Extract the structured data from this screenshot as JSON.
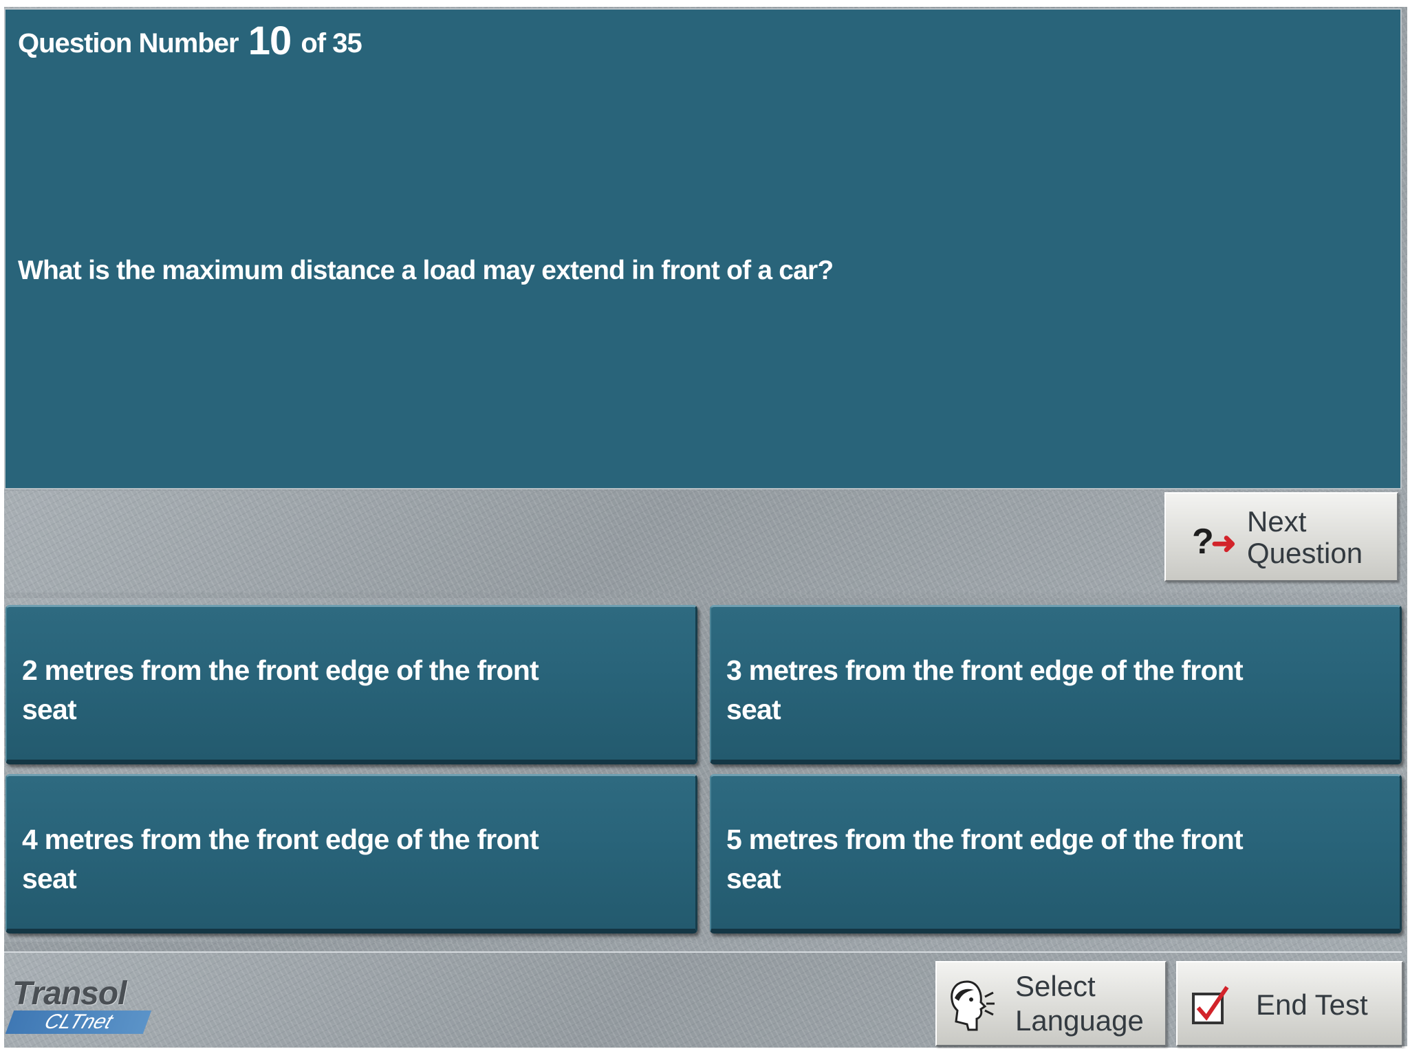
{
  "header": {
    "question_prefix": "Question Number",
    "question_number": "10",
    "question_suffix": "of 35"
  },
  "question": {
    "text": "What is the maximum distance a load may extend in front of a car?"
  },
  "next_button": {
    "line1": "Next",
    "line2": "Question",
    "icon": "question-arrow-icon"
  },
  "answers": [
    {
      "text": "2 metres from the front edge of the front seat"
    },
    {
      "text": "3 metres from the front edge of the front seat"
    },
    {
      "text": "4 metres from the front edge of the front seat"
    },
    {
      "text": "5 metres from the front edge of the front seat"
    }
  ],
  "footer": {
    "logo_line1": "Transol",
    "logo_line2": "CLTnet",
    "select_language": {
      "line1": "Select",
      "line2": "Language",
      "icon": "speaking-head-icon"
    },
    "end_test": {
      "label": "End Test",
      "icon": "checkbox-check-icon"
    }
  },
  "colors": {
    "panel": "#29647a",
    "accent_red": "#d2232a",
    "stone": "#9ba2a7"
  }
}
